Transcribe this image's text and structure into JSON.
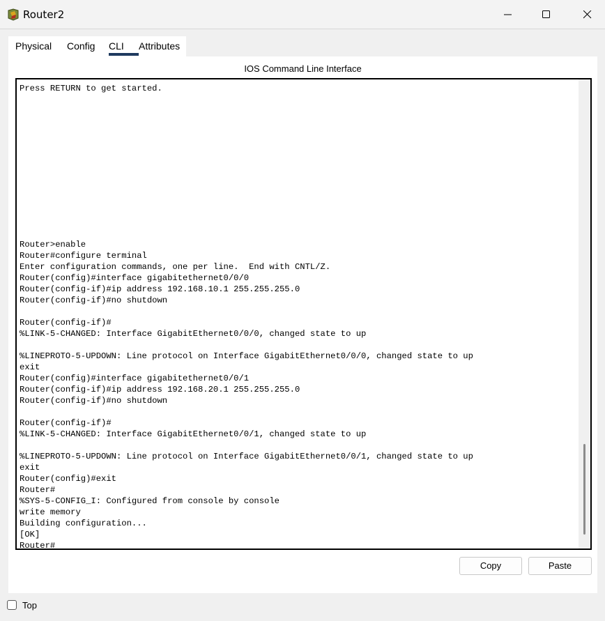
{
  "window": {
    "title": "Router2"
  },
  "tabs": [
    {
      "label": "Physical"
    },
    {
      "label": "Config"
    },
    {
      "label": "CLI"
    },
    {
      "label": "Attributes"
    }
  ],
  "active_tab": "CLI",
  "cli": {
    "header": "IOS Command Line Interface",
    "lines": [
      "Press RETURN to get started.",
      "",
      "",
      "",
      "",
      "",
      "",
      "",
      "",
      "",
      "",
      "",
      "",
      "",
      "Router>enable",
      "Router#configure terminal",
      "Enter configuration commands, one per line.  End with CNTL/Z.",
      "Router(config)#interface gigabitethernet0/0/0",
      "Router(config-if)#ip address 192.168.10.1 255.255.255.0",
      "Router(config-if)#no shutdown",
      "",
      "Router(config-if)#",
      "%LINK-5-CHANGED: Interface GigabitEthernet0/0/0, changed state to up",
      "",
      "%LINEPROTO-5-UPDOWN: Line protocol on Interface GigabitEthernet0/0/0, changed state to up",
      "exit",
      "Router(config)#interface gigabitethernet0/0/1",
      "Router(config-if)#ip address 192.168.20.1 255.255.255.0",
      "Router(config-if)#no shutdown",
      "",
      "Router(config-if)#",
      "%LINK-5-CHANGED: Interface GigabitEthernet0/0/1, changed state to up",
      "",
      "%LINEPROTO-5-UPDOWN: Line protocol on Interface GigabitEthernet0/0/1, changed state to up",
      "exit",
      "Router(config)#exit",
      "Router#",
      "%SYS-5-CONFIG_I: Configured from console by console",
      "write memory",
      "Building configuration...",
      "[OK]",
      "Router#"
    ]
  },
  "buttons": {
    "copy": "Copy",
    "paste": "Paste"
  },
  "footer": {
    "top_checkbox_label": "Top",
    "top_checked": false
  },
  "colors": {
    "active_tab_underline": "#1f3a5f",
    "terminal_border": "#000000"
  },
  "icons": {
    "app": "router-device-icon",
    "minimize": "minimize-icon",
    "maximize": "maximize-icon",
    "close": "close-icon"
  }
}
